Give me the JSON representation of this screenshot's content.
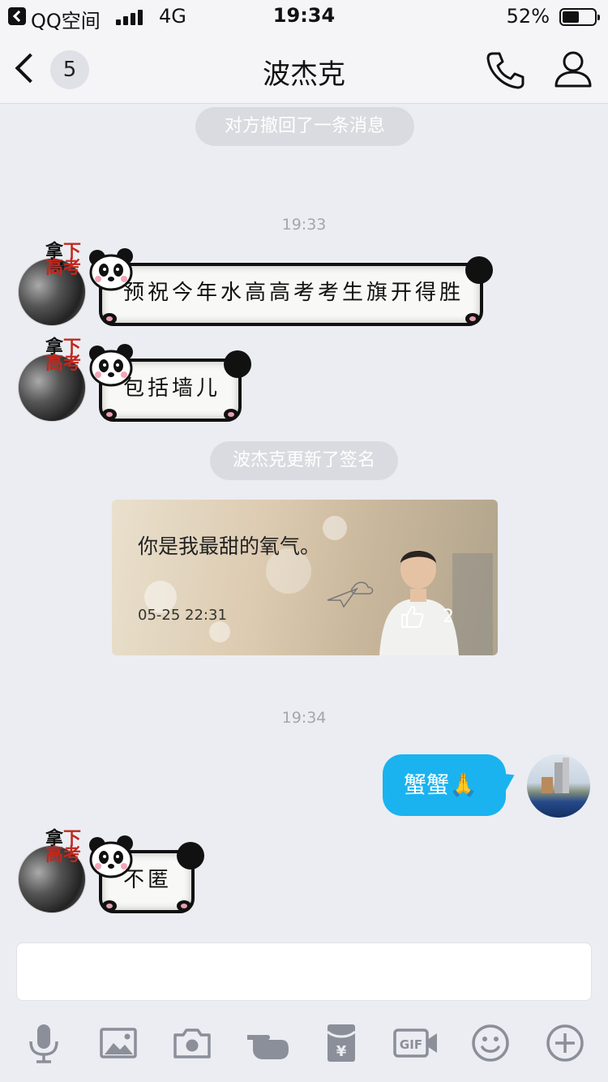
{
  "status_bar": {
    "back_app": "QQ空间",
    "network": "4G",
    "time": "19:34",
    "battery": "52%",
    "battery_level": 0.52
  },
  "nav": {
    "unread_count": "5",
    "title": "波杰克",
    "call_icon": "phone-icon",
    "profile_icon": "person-icon"
  },
  "messages": {
    "recall_notice": "对方撤回了一条消息",
    "time_1": "19:33",
    "msg_1": "预祝今年水高高考考生旗开得胜",
    "msg_2": "包括墙儿",
    "signature_notice": "波杰克更新了签名",
    "signature_card": {
      "text": "你是我最甜的氧气。",
      "date": "05-25 22:31",
      "like_count": "2"
    },
    "time_2": "19:34",
    "msg_3_outgoing": "蟹蟹🙏",
    "msg_4": "不匿"
  },
  "avatar_seal": {
    "line1": "拿",
    "line1b": "下",
    "line2": "高",
    "line2b": "考"
  },
  "input": {
    "placeholder": ""
  },
  "toolbar": {
    "icons": [
      "microphone-icon",
      "image-icon",
      "camera-icon",
      "poke-hand-icon",
      "red-packet-icon",
      "gif-icon",
      "emoji-icon",
      "plus-icon"
    ],
    "gif_label": "GIF",
    "red_packet_label": "¥"
  },
  "colors": {
    "outgoing_bubble": "#1ab3ef",
    "background": "#ebedf2"
  }
}
